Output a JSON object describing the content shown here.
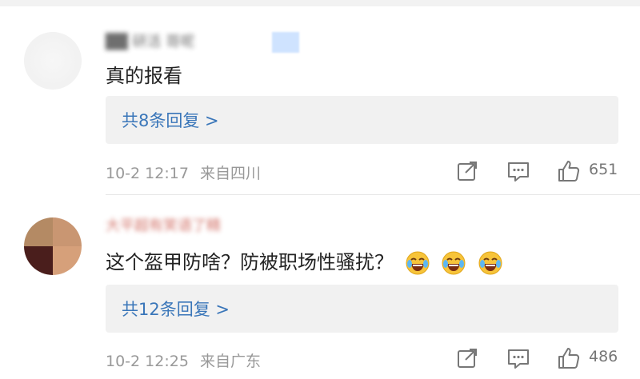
{
  "comments": [
    {
      "username": "██ 研活 哥呢",
      "text": "真的报看",
      "replies_label": "共8条回复 >",
      "time": "10-2 12:17",
      "location": "来自四川",
      "likes": "651"
    },
    {
      "username": "大平超有笑语了精",
      "text": "这个盔甲防啥？防被职场性骚扰？",
      "replies_label": "共12条回复 >",
      "time": "10-2 12:25",
      "location": "来自广东",
      "likes": "486"
    }
  ],
  "icons": {
    "share": "share-icon",
    "comment": "comment-icon",
    "like": "thumbs-up-icon",
    "emoji": "laughing-tears-emoji-icon"
  },
  "colors": {
    "reply_link": "#3a76b9",
    "meta_text": "#999999",
    "reply_bg": "#f1f1f1"
  }
}
